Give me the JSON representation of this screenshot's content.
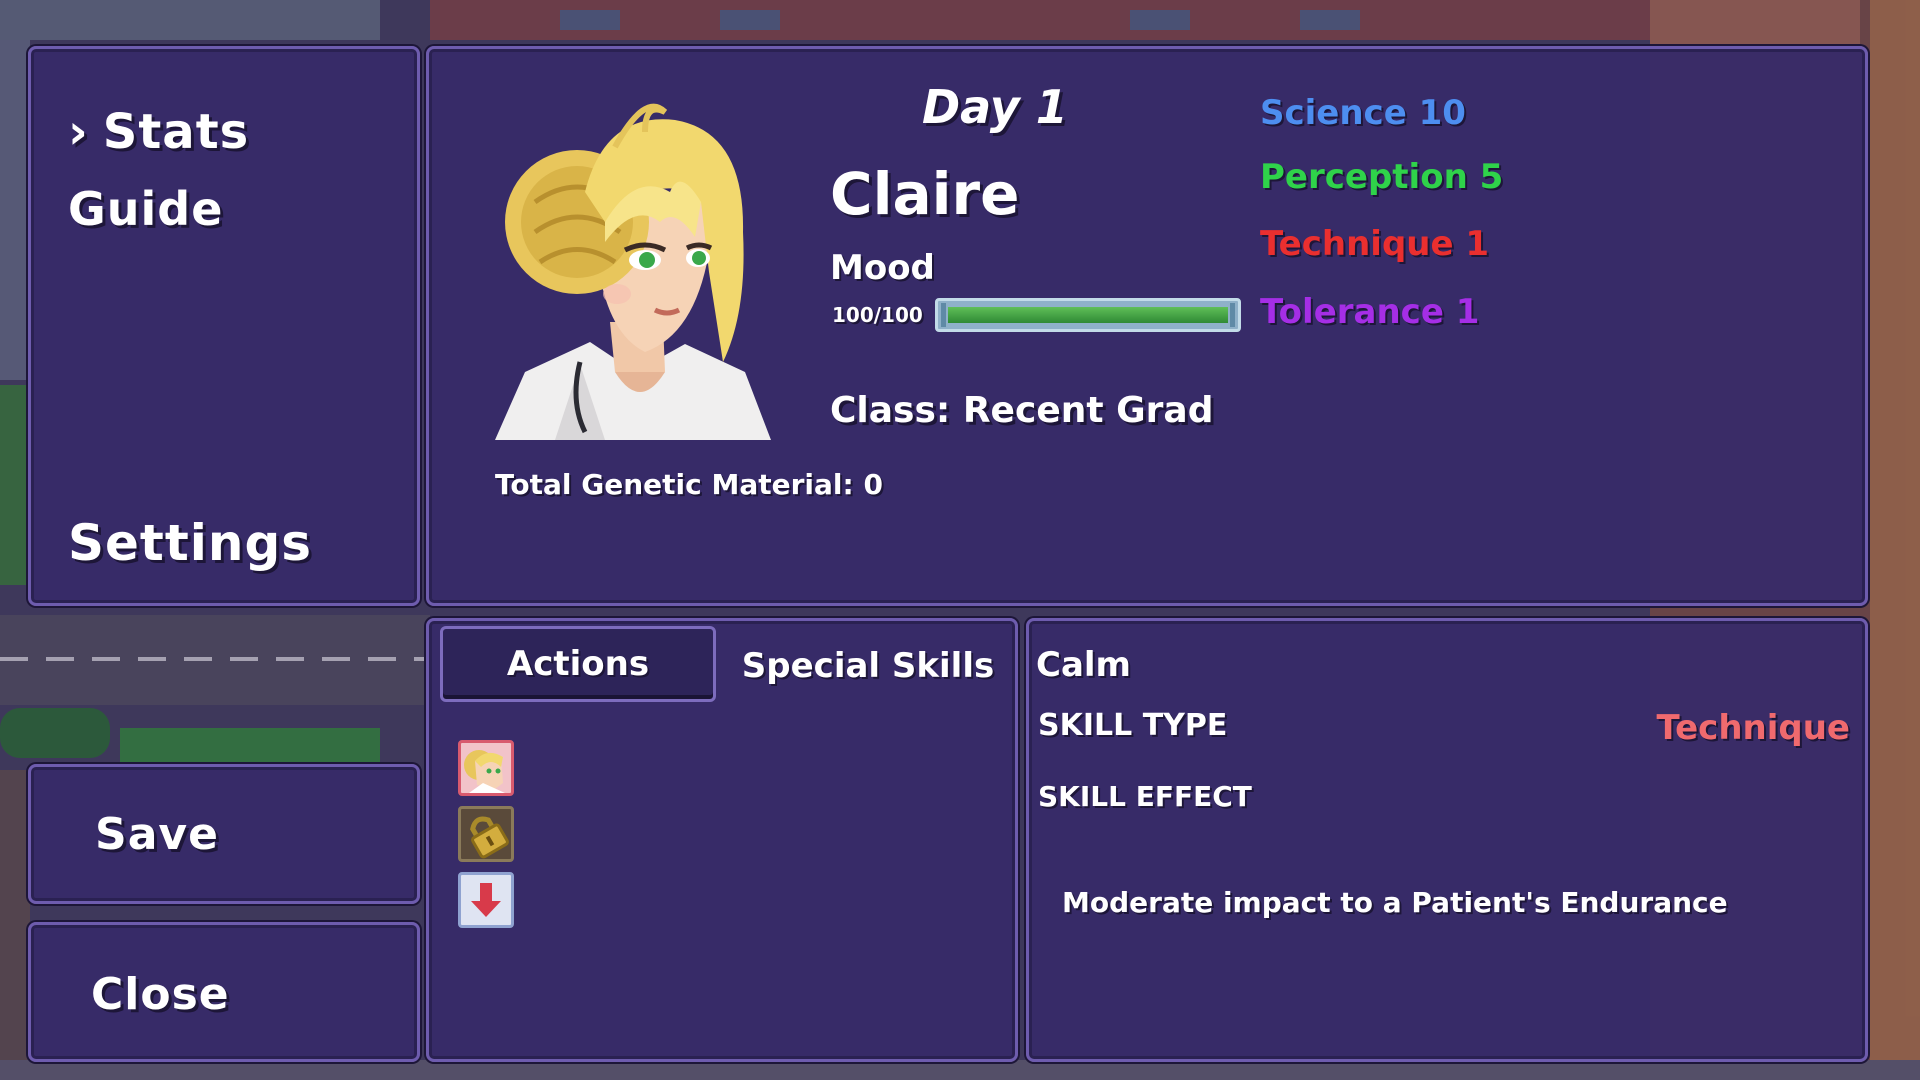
{
  "menu": {
    "items": [
      {
        "label": "Stats",
        "selected": true
      },
      {
        "label": "Guide",
        "selected": false
      }
    ],
    "settings_label": "Settings",
    "save_label": "Save",
    "close_label": "Close"
  },
  "profile": {
    "day": "Day 1",
    "name": "Claire",
    "mood_label": "Mood",
    "mood_value": "100/100",
    "mood_fraction": 1.0,
    "class_text": "Class: Recent Grad",
    "genetic_text": "Total Genetic Material: 0"
  },
  "stats": [
    {
      "label": "Science 10",
      "color": "#4d8ef0"
    },
    {
      "label": "Perception 5",
      "color": "#2fd34a"
    },
    {
      "label": "Technique 1",
      "color": "#ea2f2f"
    },
    {
      "label": "Tolerance 1",
      "color": "#a52ee6"
    }
  ],
  "tabs": {
    "actions_label": "Actions",
    "special_label": "Special Skills"
  },
  "skill_icons": [
    "claire-portrait-icon",
    "lock-icon",
    "down-arrow-icon"
  ],
  "detail": {
    "title": "Calm",
    "type_label": "SKILL TYPE",
    "type_value": "Technique",
    "effect_label": "SKILL EFFECT",
    "description": "Moderate impact to a Patient's Endurance"
  },
  "colors": {
    "panel": "#372a69",
    "panel_border": "#6e5cae",
    "skill_type": "#f06a6e",
    "mood_bar": "#3fa043"
  }
}
